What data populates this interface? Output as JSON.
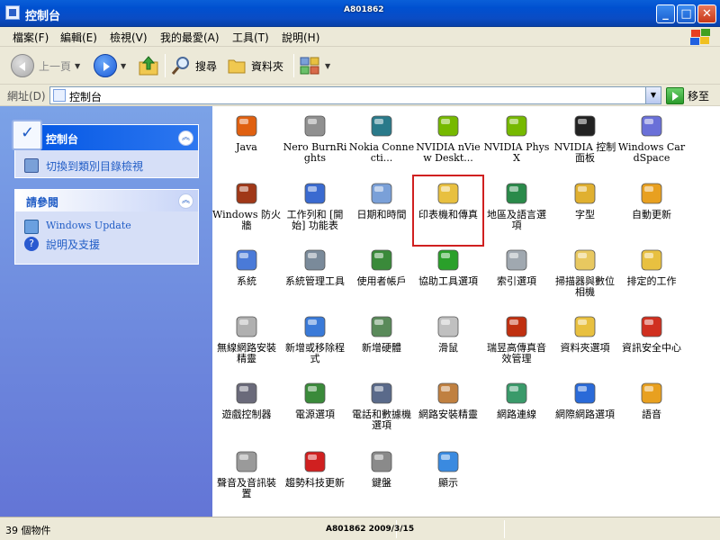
{
  "window": {
    "title": "控制台",
    "watermark_top": "A801862",
    "controls": {
      "minimize": "_",
      "maximize": "□",
      "close": "✕"
    }
  },
  "menu": [
    "檔案(F)",
    "編輯(E)",
    "檢視(V)",
    "我的最愛(A)",
    "工具(T)",
    "說明(H)"
  ],
  "toolbar": {
    "back": "上一頁",
    "search": "搜尋",
    "folders": "資料夾"
  },
  "address": {
    "label": "網址(D)",
    "value": "控制台",
    "go": "移至"
  },
  "sidebar": {
    "panel1": {
      "title": "控制台",
      "task": "切換到類別目錄檢視"
    },
    "panel2": {
      "title": "請參閱",
      "links": [
        "Windows Update",
        "說明及支援"
      ]
    }
  },
  "items": [
    {
      "label": "Java",
      "icon": "java-icon",
      "color": "#e06010"
    },
    {
      "label": "Nero BurnRights",
      "icon": "nero-icon",
      "color": "#909090"
    },
    {
      "label": "Nokia Connecti...",
      "icon": "nokia-icon",
      "color": "#2a7a8a"
    },
    {
      "label": "NVIDIA nView Deskt...",
      "icon": "nvidia-icon",
      "color": "#76b900"
    },
    {
      "label": "NVIDIA PhysX",
      "icon": "nvidia-icon",
      "color": "#76b900"
    },
    {
      "label": "NVIDIA 控制面板",
      "icon": "nvidia-panel-icon",
      "color": "#222222"
    },
    {
      "label": "Windows CardSpace",
      "icon": "cardspace-icon",
      "color": "#6a70d8"
    },
    {
      "label": "Windows 防火牆",
      "icon": "firewall-icon",
      "color": "#a03818"
    },
    {
      "label": "工作列和 [開始] 功能表",
      "icon": "taskbar-icon",
      "color": "#3a6ad0"
    },
    {
      "label": "日期和時間",
      "icon": "datetime-icon",
      "color": "#7aa0d8"
    },
    {
      "label": "印表機和傳真",
      "icon": "printer-icon",
      "color": "#e8c040"
    },
    {
      "label": "地區及語言選項",
      "icon": "globe-icon",
      "color": "#2a8a4a"
    },
    {
      "label": "字型",
      "icon": "font-icon",
      "color": "#e0b030"
    },
    {
      "label": "自動更新",
      "icon": "update-icon",
      "color": "#e8a020"
    },
    {
      "label": "系統",
      "icon": "system-icon",
      "color": "#4a7ad8"
    },
    {
      "label": "系統管理工具",
      "icon": "admin-tools-icon",
      "color": "#7a8a9a"
    },
    {
      "label": "使用者帳戶",
      "icon": "users-icon",
      "color": "#3a8a3a"
    },
    {
      "label": "協助工具選項",
      "icon": "accessibility-icon",
      "color": "#2aa02a"
    },
    {
      "label": "索引選項",
      "icon": "index-icon",
      "color": "#a0a8b0"
    },
    {
      "label": "掃描器與數位相機",
      "icon": "scanner-icon",
      "color": "#e8c860"
    },
    {
      "label": "排定的工作",
      "icon": "scheduled-icon",
      "color": "#e8c040"
    },
    {
      "label": "無線網路安裝精靈",
      "icon": "wireless-icon",
      "color": "#b0b0b0"
    },
    {
      "label": "新增或移除程式",
      "icon": "add-remove-icon",
      "color": "#3a7ad8"
    },
    {
      "label": "新增硬體",
      "icon": "hardware-icon",
      "color": "#5a8a5a"
    },
    {
      "label": "滑鼠",
      "icon": "mouse-icon",
      "color": "#c0c0c0"
    },
    {
      "label": "瑞昱高傳真音效管理",
      "icon": "speaker-icon",
      "color": "#c03010"
    },
    {
      "label": "資料夾選項",
      "icon": "folder-options-icon",
      "color": "#e8c040"
    },
    {
      "label": "資訊安全中心",
      "icon": "security-icon",
      "color": "#d03020"
    },
    {
      "label": "遊戲控制器",
      "icon": "gamepad-icon",
      "color": "#6a6a7a"
    },
    {
      "label": "電源選項",
      "icon": "power-icon",
      "color": "#3a8a3a"
    },
    {
      "label": "電話和數據機選項",
      "icon": "phone-icon",
      "color": "#5a6a8a"
    },
    {
      "label": "網路安裝精靈",
      "icon": "network-setup-icon",
      "color": "#c08040"
    },
    {
      "label": "網路連線",
      "icon": "network-icon",
      "color": "#3a9a6a"
    },
    {
      "label": "網際網路選項",
      "icon": "internet-icon",
      "color": "#2a6ad8"
    },
    {
      "label": "語音",
      "icon": "speech-icon",
      "color": "#e8a020"
    },
    {
      "label": "聲音及音訊裝置",
      "icon": "sound-icon",
      "color": "#9a9a9a"
    },
    {
      "label": "趨勢科技更新",
      "icon": "trend-icon",
      "color": "#d02020"
    },
    {
      "label": "鍵盤",
      "icon": "keyboard-icon",
      "color": "#8a8a8a"
    },
    {
      "label": "顯示",
      "icon": "display-icon",
      "color": "#3a8ae0"
    }
  ],
  "selected_item": "印表機和傳真",
  "status": {
    "count": "39 個物件",
    "watermark_bottom": "A801862 2009/3/15"
  }
}
